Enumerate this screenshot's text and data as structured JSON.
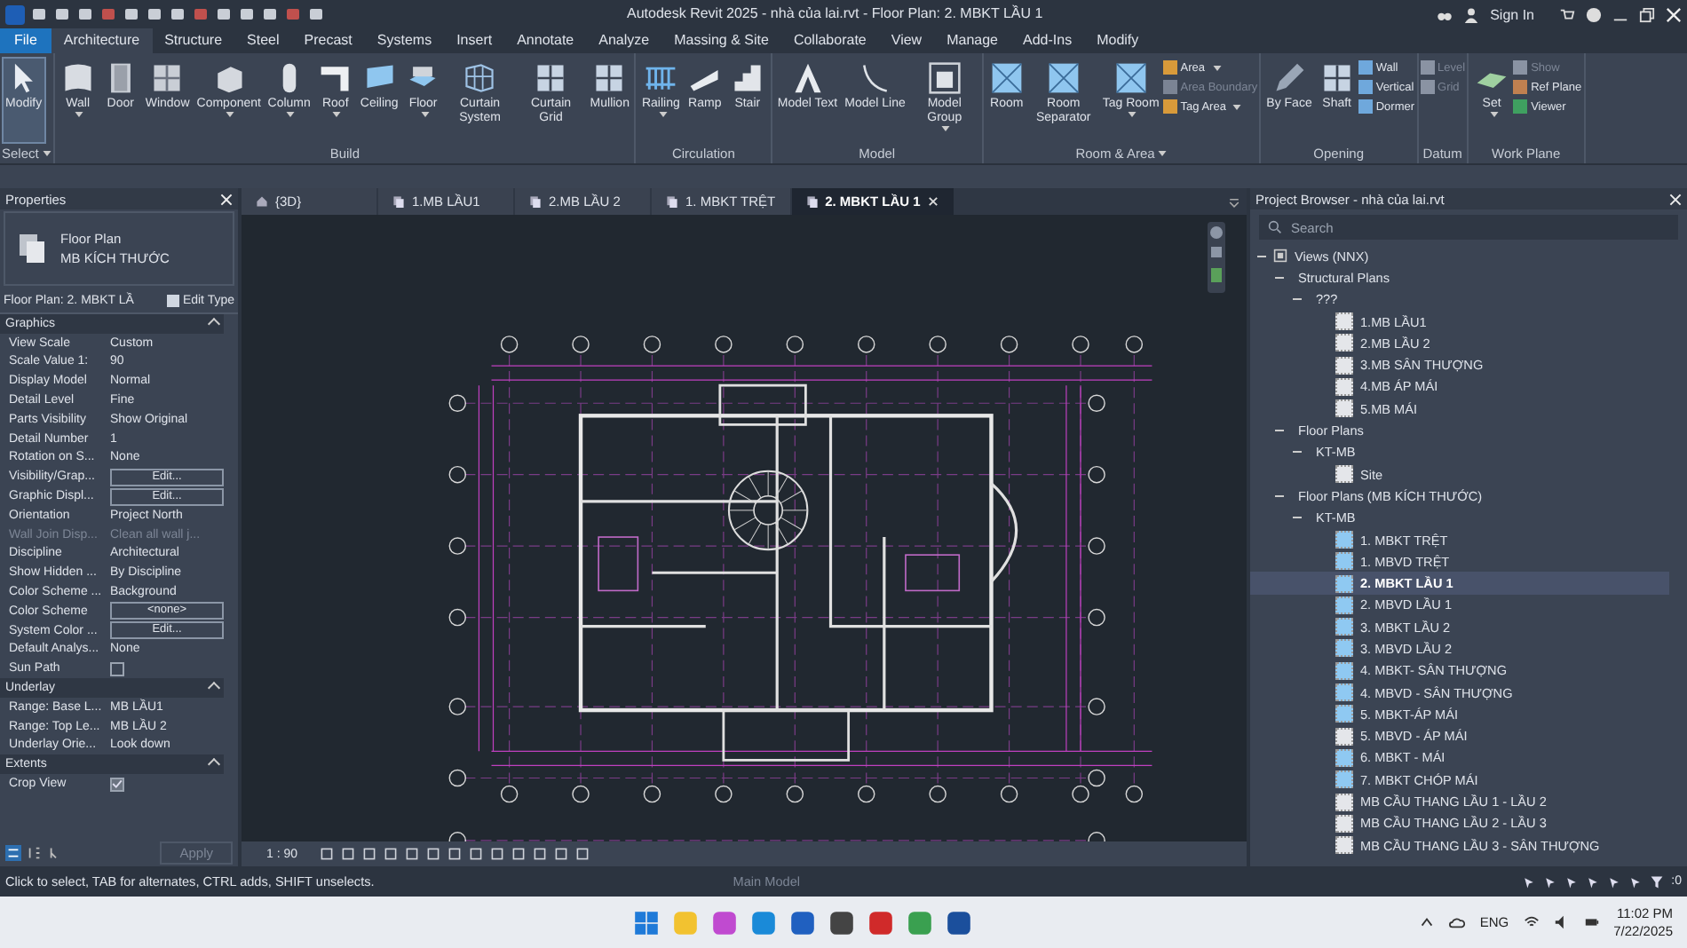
{
  "title_bar": {
    "title": "Autodesk Revit 2025 - nhà của lai.rvt - Floor Plan: 2. MBKT LẦU 1",
    "sign_in": "Sign In"
  },
  "ribbon_tabs": [
    {
      "label": "File",
      "kind": "file",
      "selected": false
    },
    {
      "label": "Architecture",
      "kind": "tab",
      "selected": true
    },
    {
      "label": "Structure",
      "kind": "tab",
      "selected": false
    },
    {
      "label": "Steel",
      "kind": "tab",
      "selected": false
    },
    {
      "label": "Precast",
      "kind": "tab",
      "selected": false
    },
    {
      "label": "Systems",
      "kind": "tab",
      "selected": false
    },
    {
      "label": "Insert",
      "kind": "tab",
      "selected": false
    },
    {
      "label": "Annotate",
      "kind": "tab",
      "selected": false
    },
    {
      "label": "Analyze",
      "kind": "tab",
      "selected": false
    },
    {
      "label": "Massing & Site",
      "kind": "tab",
      "selected": false
    },
    {
      "label": "Collaborate",
      "kind": "tab",
      "selected": false
    },
    {
      "label": "View",
      "kind": "tab",
      "selected": false
    },
    {
      "label": "Manage",
      "kind": "tab",
      "selected": false
    },
    {
      "label": "Add-Ins",
      "kind": "tab",
      "selected": false
    },
    {
      "label": "Modify",
      "kind": "tab",
      "selected": false
    }
  ],
  "ribbon_panels": [
    {
      "title": "Select",
      "has_menu": true,
      "tools": [
        {
          "label": "Modify",
          "has_menu": false,
          "selected": true
        }
      ]
    },
    {
      "title": "Build",
      "has_menu": false,
      "tools": [
        {
          "label": "Wall",
          "has_menu": true,
          "selected": false
        },
        {
          "label": "Door",
          "has_menu": false,
          "selected": false
        },
        {
          "label": "Window",
          "has_menu": false,
          "selected": false
        },
        {
          "label": "Component",
          "has_menu": true,
          "selected": false
        },
        {
          "label": "Column",
          "has_menu": true,
          "selected": false
        },
        {
          "label": "Roof",
          "has_menu": true,
          "selected": false
        },
        {
          "label": "Ceiling",
          "has_menu": false,
          "selected": false
        },
        {
          "label": "Floor",
          "has_menu": true,
          "selected": false
        },
        {
          "label": "Curtain System",
          "has_menu": false,
          "selected": false
        },
        {
          "label": "Curtain Grid",
          "has_menu": false,
          "selected": false
        },
        {
          "label": "Mullion",
          "has_menu": false,
          "selected": false
        }
      ]
    },
    {
      "title": "Circulation",
      "has_menu": false,
      "tools": [
        {
          "label": "Railing",
          "has_menu": true,
          "selected": false
        },
        {
          "label": "Ramp",
          "has_menu": false,
          "selected": false
        },
        {
          "label": "Stair",
          "has_menu": false,
          "selected": false
        }
      ]
    },
    {
      "title": "Model",
      "has_menu": false,
      "tools": [
        {
          "label": "Model Text",
          "has_menu": false,
          "selected": false
        },
        {
          "label": "Model Line",
          "has_menu": false,
          "selected": false
        },
        {
          "label": "Model Group",
          "has_menu": true,
          "selected": false
        }
      ]
    },
    {
      "title": "Room & Area",
      "has_menu": true,
      "tools": [
        {
          "label": "Room",
          "has_menu": false,
          "selected": false
        },
        {
          "label": "Room Separator",
          "has_menu": false,
          "selected": false
        },
        {
          "label": "Tag Room",
          "has_menu": true,
          "selected": false
        }
      ],
      "small_tools": [
        {
          "label": "Area",
          "has_menu": true,
          "disabled": false
        },
        {
          "label": "Area  Boundary",
          "has_menu": false,
          "disabled": true
        },
        {
          "label": "Tag  Area",
          "has_menu": true,
          "disabled": false
        }
      ]
    },
    {
      "title": "Opening",
      "has_menu": false,
      "tools": [
        {
          "label": "By Face",
          "has_menu": false,
          "selected": false
        },
        {
          "label": "Shaft",
          "has_menu": false,
          "selected": false
        }
      ],
      "small_tools": [
        {
          "label": "Wall",
          "has_menu": false,
          "disabled": false
        },
        {
          "label": "Vertical",
          "has_menu": false,
          "disabled": false
        },
        {
          "label": "Dormer",
          "has_menu": false,
          "disabled": false
        }
      ]
    },
    {
      "title": "Datum",
      "has_menu": false,
      "small_tools": [
        {
          "label": "Level",
          "has_menu": false,
          "disabled": true
        },
        {
          "label": "Grid",
          "has_menu": false,
          "disabled": true
        }
      ]
    },
    {
      "title": "Work Plane",
      "has_menu": false,
      "tools": [
        {
          "label": "Set",
          "has_menu": true,
          "selected": false
        }
      ],
      "small_tools": [
        {
          "label": "Show",
          "has_menu": false,
          "disabled": true
        },
        {
          "label": "Ref  Plane",
          "has_menu": false,
          "disabled": false
        },
        {
          "label": "Viewer",
          "has_menu": false,
          "disabled": false
        }
      ]
    }
  ],
  "properties": {
    "title": "Properties",
    "type_family": "Floor Plan",
    "type_name": "MB KÍCH THƯỚC",
    "instance": "Floor Plan: 2. MBKT LẦ",
    "edit_type": "Edit Type",
    "apply": "Apply",
    "groups": [
      {
        "title": "Graphics",
        "expanded": true,
        "params": [
          {
            "name": "View Scale",
            "value": "Custom",
            "kind": "text",
            "disabled": false
          },
          {
            "name": "Scale Value    1:",
            "value": "90",
            "kind": "text",
            "disabled": false
          },
          {
            "name": "Display Model",
            "value": "Normal",
            "kind": "text",
            "disabled": false
          },
          {
            "name": "Detail Level",
            "value": "Fine",
            "kind": "text",
            "disabled": false
          },
          {
            "name": "Parts Visibility",
            "value": "Show Original",
            "kind": "text",
            "disabled": false
          },
          {
            "name": "Detail Number",
            "value": "1",
            "kind": "text",
            "disabled": false
          },
          {
            "name": "Rotation on S...",
            "value": "None",
            "kind": "text",
            "disabled": false
          },
          {
            "name": "Visibility/Grap...",
            "value": "Edit...",
            "kind": "button",
            "disabled": false
          },
          {
            "name": "Graphic Displ...",
            "value": "Edit...",
            "kind": "button",
            "disabled": false
          },
          {
            "name": "Orientation",
            "value": "Project North",
            "kind": "text",
            "disabled": false
          },
          {
            "name": "Wall Join Disp...",
            "value": "Clean all wall j...",
            "kind": "text",
            "disabled": true
          },
          {
            "name": "Discipline",
            "value": "Architectural",
            "kind": "text",
            "disabled": false
          },
          {
            "name": "Show Hidden ...",
            "value": "By Discipline",
            "kind": "text",
            "disabled": false
          },
          {
            "name": "Color Scheme ...",
            "value": "Background",
            "kind": "text",
            "disabled": false
          },
          {
            "name": "Color Scheme",
            "value": "<none>",
            "kind": "button",
            "disabled": false
          },
          {
            "name": "System Color ...",
            "value": "Edit...",
            "kind": "button",
            "disabled": false
          },
          {
            "name": "Default Analys...",
            "value": "None",
            "kind": "text",
            "disabled": false
          },
          {
            "name": "Sun Path",
            "checked": false,
            "kind": "checkbox",
            "disabled": false
          }
        ]
      },
      {
        "title": "Underlay",
        "expanded": true,
        "params": [
          {
            "name": "Range: Base L...",
            "value": "MB LẦU1",
            "kind": "text",
            "disabled": false
          },
          {
            "name": "Range: Top Le...",
            "value": "MB LẦU 2",
            "kind": "text",
            "disabled": false
          },
          {
            "name": "Underlay Orie...",
            "value": "Look down",
            "kind": "text",
            "disabled": false
          }
        ]
      },
      {
        "title": "Extents",
        "expanded": true,
        "params": [
          {
            "name": "Crop View",
            "checked": true,
            "kind": "checkbox",
            "disabled": false
          }
        ]
      }
    ]
  },
  "view_tabs": [
    {
      "label": "{3D}",
      "kind": "model",
      "selected": false
    },
    {
      "label": "1.MB LẦU1",
      "kind": "plan",
      "selected": false
    },
    {
      "label": "2.MB LẦU 2",
      "kind": "plan",
      "selected": false
    },
    {
      "label": "1. MBKT TRỆT",
      "kind": "plan",
      "selected": false
    },
    {
      "label": "2. MBKT LẦU 1",
      "kind": "plan",
      "selected": true
    }
  ],
  "view_control": {
    "scale": "1 : 90"
  },
  "project_browser": {
    "title": "Project Browser - nhà của lai.rvt",
    "search_placeholder": "Search",
    "tree": [
      {
        "label": "Views (NNX)",
        "kind": "root",
        "expanded": true,
        "children": [
          {
            "label": "Structural Plans",
            "kind": "group",
            "expanded": true,
            "children": [
              {
                "label": "???",
                "kind": "group",
                "expanded": true,
                "children": [
                  {
                    "label": "1.MB LẦU1",
                    "kind": "view",
                    "on_sheet": false,
                    "selected": false
                  },
                  {
                    "label": "2.MB LẦU 2",
                    "kind": "view",
                    "on_sheet": false,
                    "selected": false
                  },
                  {
                    "label": "3.MB SÂN THƯỢNG",
                    "kind": "view",
                    "on_sheet": false,
                    "selected": false
                  },
                  {
                    "label": "4.MB ÁP MÁI",
                    "kind": "view",
                    "on_sheet": false,
                    "selected": false
                  },
                  {
                    "label": "5.MB MÁI",
                    "kind": "view",
                    "on_sheet": false,
                    "selected": false
                  }
                ]
              }
            ]
          },
          {
            "label": "Floor Plans",
            "kind": "group",
            "expanded": true,
            "children": [
              {
                "label": "KT-MB",
                "kind": "group",
                "expanded": true,
                "children": [
                  {
                    "label": "Site",
                    "kind": "view",
                    "on_sheet": false,
                    "selected": false
                  }
                ]
              }
            ]
          },
          {
            "label": "Floor Plans (MB KÍCH THƯỚC)",
            "kind": "group",
            "expanded": true,
            "children": [
              {
                "label": "KT-MB",
                "kind": "group",
                "expanded": true,
                "children": [
                  {
                    "label": "1. MBKT TRỆT",
                    "kind": "view",
                    "on_sheet": true,
                    "selected": false
                  },
                  {
                    "label": "1. MBVD TRỆT",
                    "kind": "view",
                    "on_sheet": true,
                    "selected": false
                  },
                  {
                    "label": "2. MBKT LẦU 1",
                    "kind": "view",
                    "on_sheet": true,
                    "selected": true
                  },
                  {
                    "label": "2. MBVD LẦU 1",
                    "kind": "view",
                    "on_sheet": true,
                    "selected": false
                  },
                  {
                    "label": "3. MBKT LẦU 2",
                    "kind": "view",
                    "on_sheet": true,
                    "selected": false
                  },
                  {
                    "label": "3. MBVD LẦU 2",
                    "kind": "view",
                    "on_sheet": true,
                    "selected": false
                  },
                  {
                    "label": "4. MBKT- SÂN THƯỢNG",
                    "kind": "view",
                    "on_sheet": true,
                    "selected": false
                  },
                  {
                    "label": "4. MBVD - SÂN THƯỢNG",
                    "kind": "view",
                    "on_sheet": true,
                    "selected": false
                  },
                  {
                    "label": "5. MBKT-ÁP MÁI",
                    "kind": "view",
                    "on_sheet": true,
                    "selected": false
                  },
                  {
                    "label": "5. MBVD - ÁP MÁI",
                    "kind": "view",
                    "on_sheet": false,
                    "selected": false
                  },
                  {
                    "label": "6. MBKT - MÁI",
                    "kind": "view",
                    "on_sheet": true,
                    "selected": false
                  },
                  {
                    "label": "7. MBKT CHÓP MÁI",
                    "kind": "view",
                    "on_sheet": true,
                    "selected": false
                  },
                  {
                    "label": "MB CẦU THANG LẦU 1 - LẦU 2",
                    "kind": "view",
                    "on_sheet": false,
                    "selected": false
                  },
                  {
                    "label": "MB CẦU THANG LẦU 2 - LẦU 3",
                    "kind": "view",
                    "on_sheet": false,
                    "selected": false
                  },
                  {
                    "label": "MB CẦU THANG LẦU 3 - SÂN THƯỢNG",
                    "kind": "view",
                    "on_sheet": false,
                    "selected": false
                  }
                ]
              }
            ]
          }
        ]
      }
    ]
  },
  "status_bar": {
    "message": "Click to select, TAB for alternates, CTRL adds, SHIFT unselects.",
    "model": "Main Model",
    "filter_count": ":0"
  },
  "taskbar": {
    "language": "ENG",
    "time": "11:02 PM",
    "date": "7/22/2025"
  }
}
